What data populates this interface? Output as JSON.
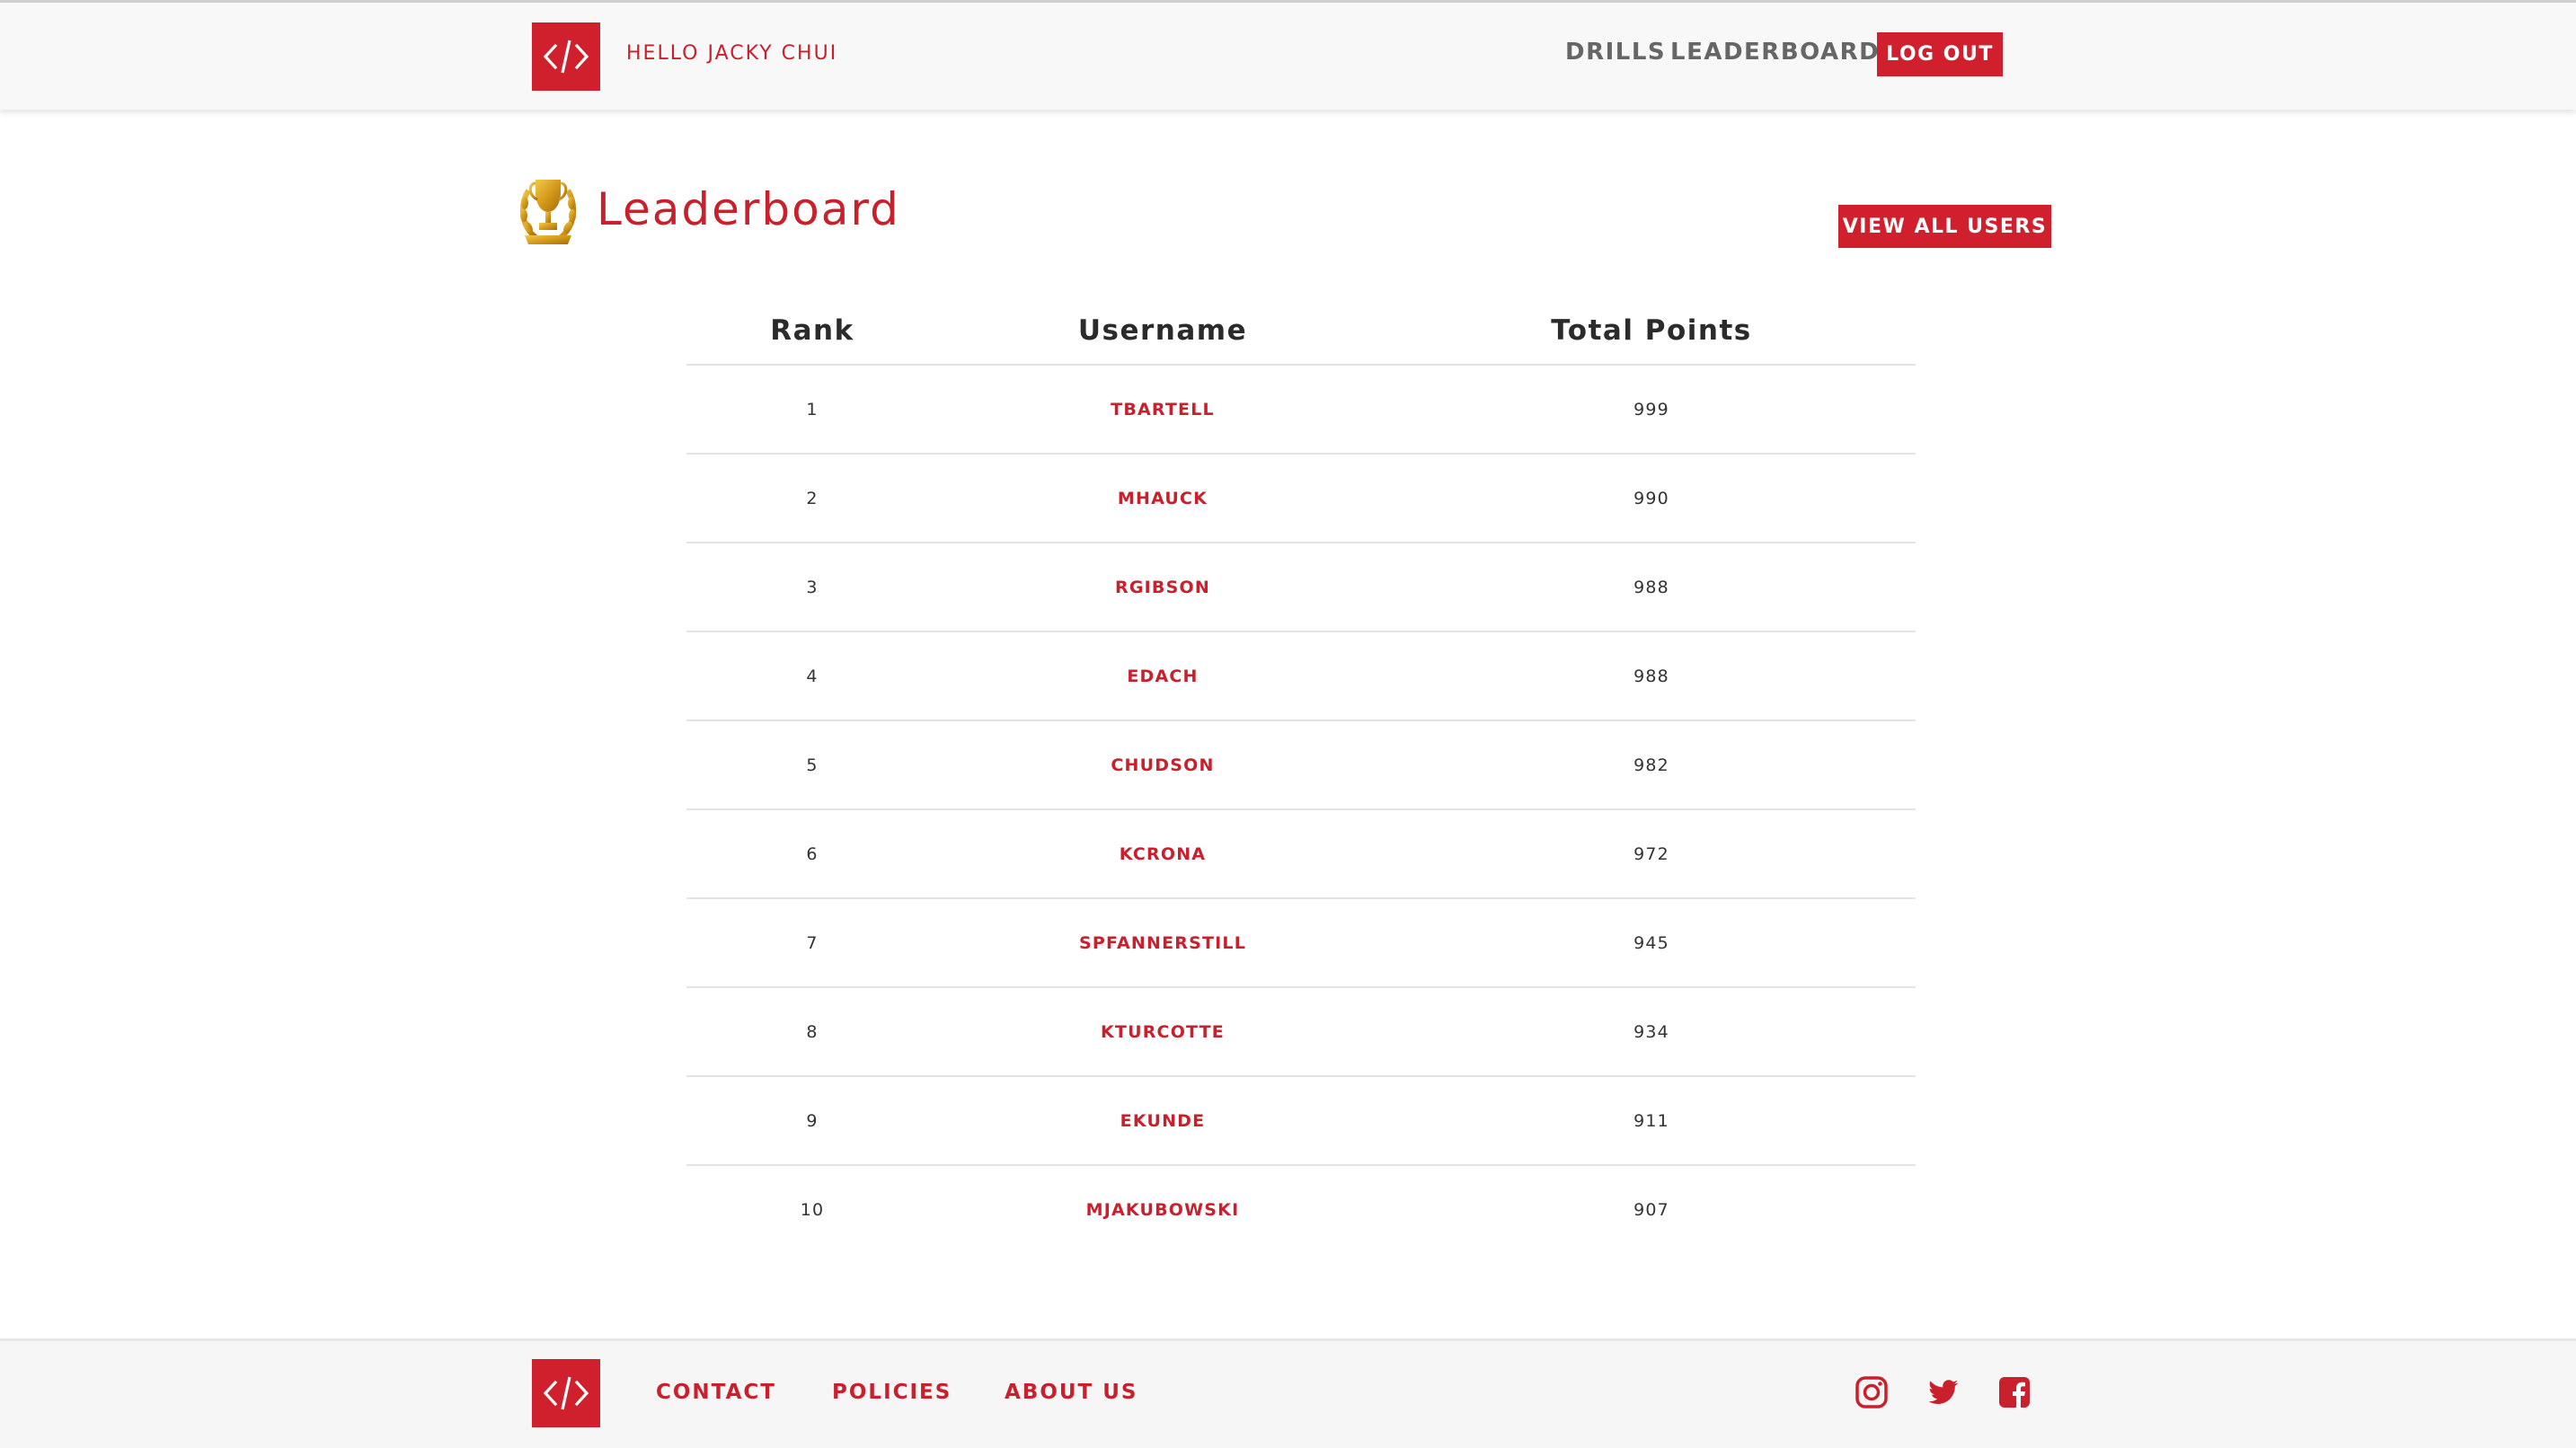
{
  "header": {
    "greeting": "HELLO JACKY CHUI",
    "nav": {
      "drills": "DRILLS",
      "leaderboard": "LEADERBOARD",
      "logout": "LOG OUT"
    }
  },
  "page": {
    "title": "Leaderboard",
    "view_all_label": "VIEW ALL USERS"
  },
  "table": {
    "columns": [
      "Rank",
      "Username",
      "Total Points"
    ],
    "rows": [
      {
        "rank": "1",
        "username": "TBARTELL",
        "points": "999"
      },
      {
        "rank": "2",
        "username": "MHAUCK",
        "points": "990"
      },
      {
        "rank": "3",
        "username": "RGIBSON",
        "points": "988"
      },
      {
        "rank": "4",
        "username": "EDACH",
        "points": "988"
      },
      {
        "rank": "5",
        "username": "CHUDSON",
        "points": "982"
      },
      {
        "rank": "6",
        "username": "KCRONA",
        "points": "972"
      },
      {
        "rank": "7",
        "username": "SPFANNERSTILL",
        "points": "945"
      },
      {
        "rank": "8",
        "username": "KTURCOTTE",
        "points": "934"
      },
      {
        "rank": "9",
        "username": "EKUNDE",
        "points": "911"
      },
      {
        "rank": "10",
        "username": "MJAKUBOWSKI",
        "points": "907"
      }
    ]
  },
  "footer": {
    "links": {
      "contact": "CONTACT",
      "policies": "POLICIES",
      "about": "ABOUT US"
    },
    "social_icons": [
      "instagram-icon",
      "twitter-icon",
      "facebook-icon"
    ]
  },
  "colors": {
    "brand_red": "#d0202e",
    "text_dark": "#2b2b2b",
    "nav_gray": "#666666"
  }
}
